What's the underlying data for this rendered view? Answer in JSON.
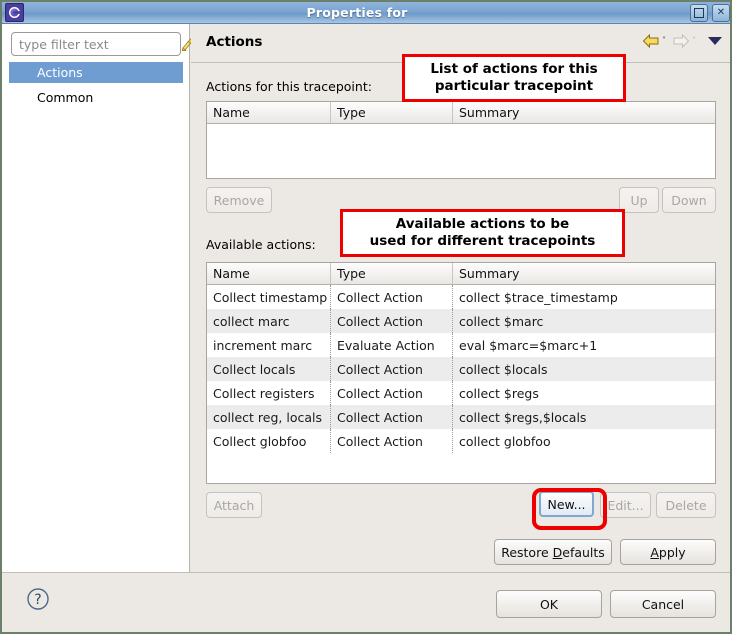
{
  "window": {
    "title": "Properties for",
    "app_icon": "eclipse-icon",
    "controls": [
      {
        "name": "maximize-button",
        "icon": "maximize-icon",
        "label": ""
      },
      {
        "name": "close-button",
        "icon": "close-icon",
        "label": "✕"
      }
    ]
  },
  "sidebar": {
    "filter": {
      "placeholder": "type filter text",
      "value": "",
      "clear_icon": "broom-icon"
    },
    "items": [
      {
        "label": "Actions",
        "selected": true
      },
      {
        "label": "Common",
        "selected": false
      }
    ]
  },
  "page": {
    "title": "Actions",
    "nav": {
      "back_icon": "back-arrow-icon",
      "back_caret": "˅",
      "forward_icon": "forward-arrow-icon",
      "forward_caret": "˅",
      "menu_icon": "view-menu-triangle-icon"
    },
    "tracepoint_section": {
      "label": "Actions for this tracepoint:",
      "columns": [
        "Name",
        "Type",
        "Summary"
      ],
      "rows": [],
      "buttons": [
        {
          "label": "Remove",
          "name": "remove-button",
          "enabled": false
        },
        {
          "label": "Up",
          "name": "up-button",
          "enabled": false
        },
        {
          "label": "Down",
          "name": "down-button",
          "enabled": false
        }
      ]
    },
    "available_section": {
      "label": "Available actions:",
      "columns": [
        "Name",
        "Type",
        "Summary"
      ],
      "rows": [
        {
          "name": "Collect timestamp",
          "type": "Collect Action",
          "summary": "collect $trace_timestamp"
        },
        {
          "name": "collect marc",
          "type": "Collect Action",
          "summary": "collect $marc"
        },
        {
          "name": "increment marc",
          "type": "Evaluate Action",
          "summary": "eval $marc=$marc+1"
        },
        {
          "name": "Collect locals",
          "type": "Collect Action",
          "summary": "collect $locals"
        },
        {
          "name": "Collect registers",
          "type": "Collect Action",
          "summary": "collect $regs"
        },
        {
          "name": "collect reg, locals",
          "type": "Collect Action",
          "summary": "collect $regs,$locals"
        },
        {
          "name": "Collect globfoo",
          "type": "Collect Action",
          "summary": "collect globfoo"
        }
      ],
      "buttons": [
        {
          "label": "Attach",
          "name": "attach-button",
          "enabled": false
        },
        {
          "label": "New...",
          "name": "new-button",
          "enabled": true
        },
        {
          "label": "Edit...",
          "name": "edit-button",
          "enabled": false
        },
        {
          "label": "Delete",
          "name": "delete-button",
          "enabled": false
        }
      ]
    },
    "page_buttons": {
      "restore_defaults": "Restore Defaults",
      "restore_defaults_mnemonic": "D",
      "apply": "Apply",
      "apply_mnemonic": "A"
    }
  },
  "footer": {
    "help_icon": "help-question-icon",
    "ok": "OK",
    "cancel": "Cancel"
  },
  "annotations": [
    {
      "name": "annotation-tracepoint-list",
      "line1": "List of actions for this",
      "line2": "particular tracepoint",
      "color": "#ee0000"
    },
    {
      "name": "annotation-available-actions",
      "line1": "Available actions to be",
      "line2": "used for different tracepoints",
      "color": "#ee0000"
    }
  ]
}
